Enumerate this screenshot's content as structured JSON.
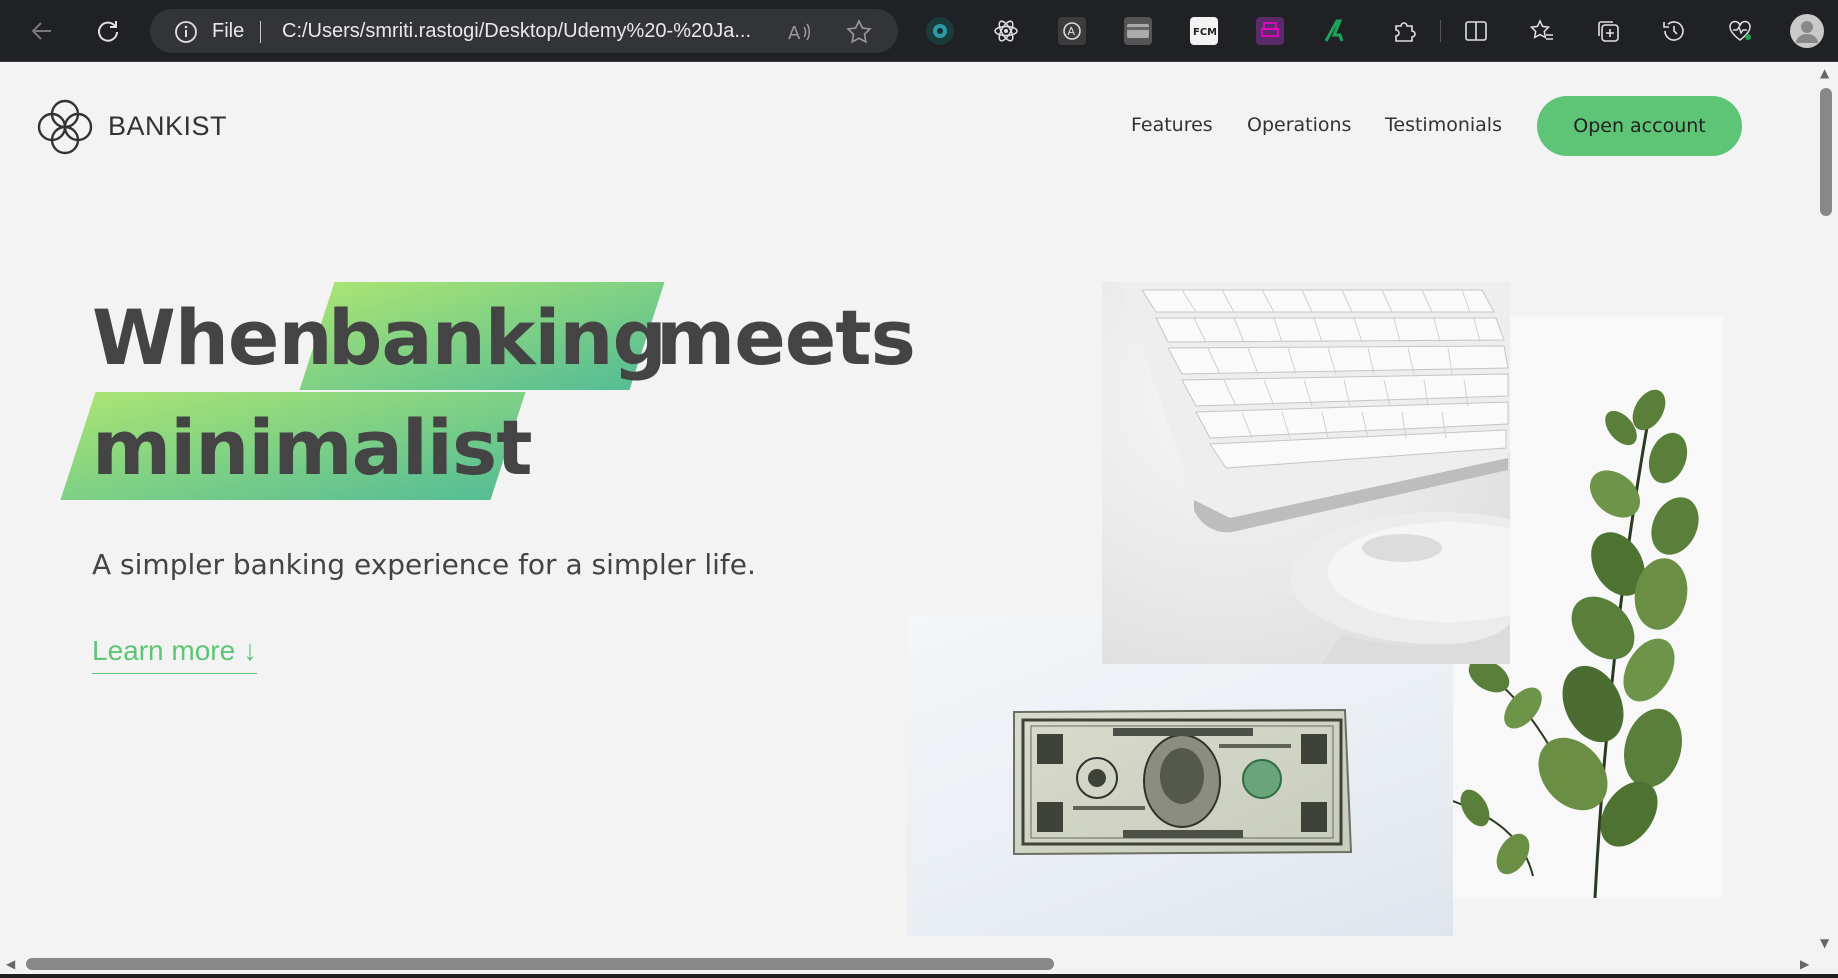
{
  "browser": {
    "url_scheme_label": "File",
    "url": "C:/Users/smriti.rastogi/Desktop/Udemy%20-%20Ja...",
    "icons": [
      "back-icon",
      "refresh-icon",
      "info-icon",
      "read-aloud-icon",
      "favorite-star-icon",
      "extension-icons",
      "puzzle-icon",
      "split-screen-icon",
      "favorites-icon",
      "collections-icon",
      "history-icon",
      "health-icon",
      "profile-avatar-icon"
    ]
  },
  "header": {
    "brand": "BANKIST",
    "nav": [
      "Features",
      "Operations",
      "Testimonials"
    ],
    "cta": "Open account"
  },
  "hero": {
    "title_word_1": "When",
    "title_word_2": "banking",
    "title_word_3": "meets",
    "title_word_4": "minimalist",
    "subtitle": "A simpler banking experience for a simpler life.",
    "learn_more": "Learn more ↓",
    "images": [
      "keyboard-and-mouse",
      "one-dollar-bill",
      "eucalyptus-plant"
    ]
  },
  "colors": {
    "accent_green": "#5ec576",
    "highlight_from": "#9be15d",
    "highlight_to": "#39b385",
    "text_dark": "#444444"
  }
}
